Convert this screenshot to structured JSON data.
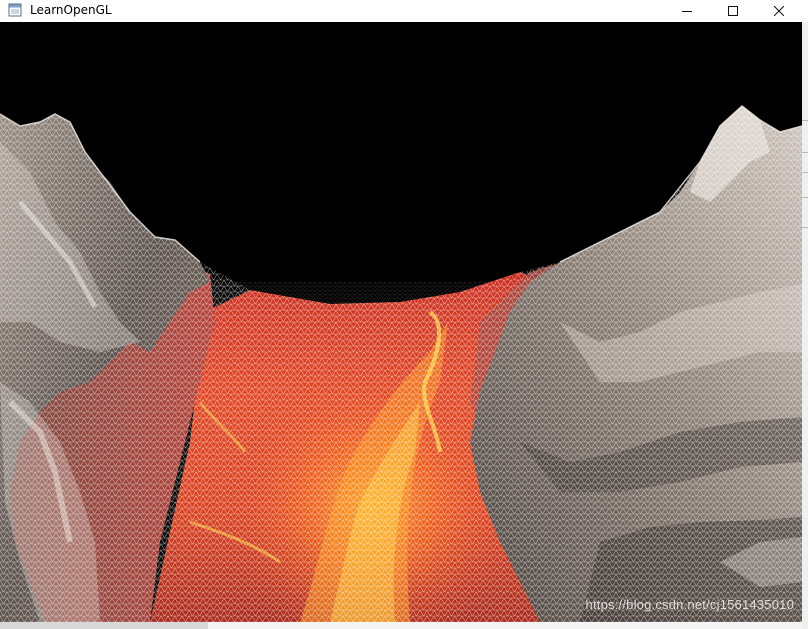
{
  "window": {
    "title": "LearnOpenGL",
    "controls": {
      "minimize_icon": "minimize-icon",
      "maximize_icon": "maximize-icon",
      "close_icon": "close-icon"
    }
  },
  "viewport": {
    "scene": "wireframe-terrain-lava-canyon",
    "background_color": "#000000",
    "lava_color": "#d7261a",
    "rock_color": "#b8aea4"
  },
  "watermark": "https://blog.csdn.net/cj1561435010"
}
